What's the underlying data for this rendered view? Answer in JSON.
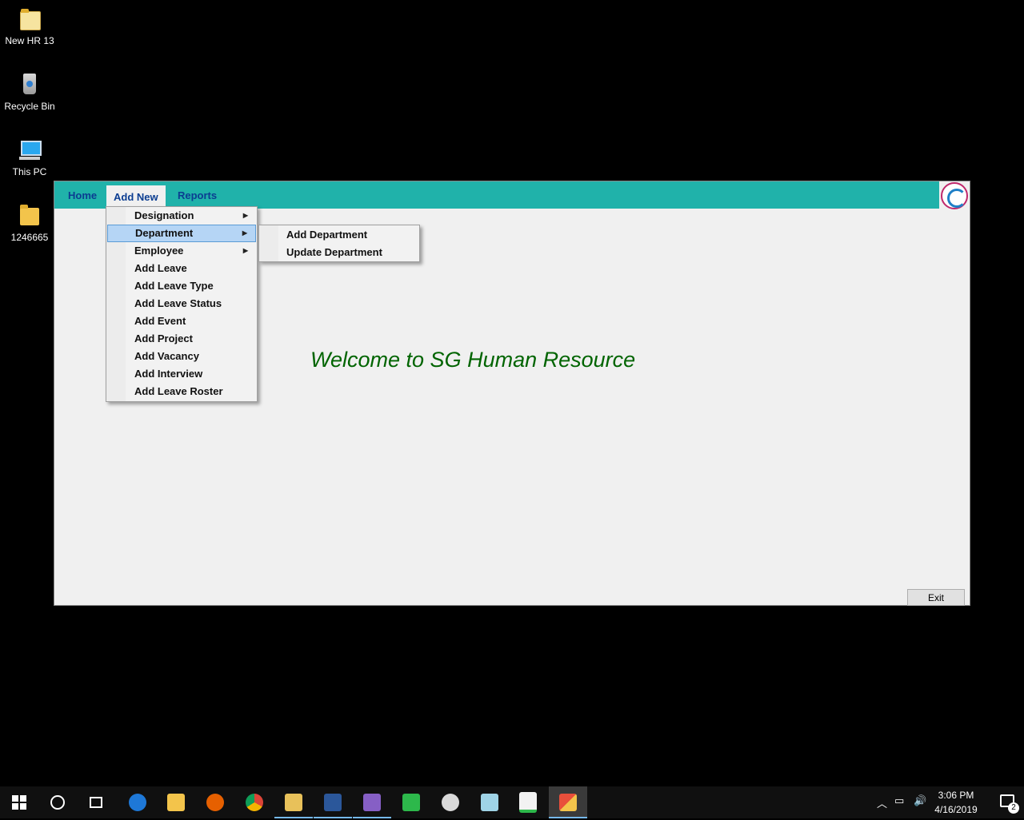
{
  "desktop": {
    "icons": [
      {
        "label": "New HR 13"
      },
      {
        "label": "Recycle Bin"
      },
      {
        "label": "This PC"
      },
      {
        "label": "1246665"
      }
    ]
  },
  "app": {
    "menubar": {
      "home": "Home",
      "add_new": "Add New",
      "reports": "Reports"
    },
    "welcome": "Welcome to SG Human Resource",
    "exit_label": "Exit",
    "colors": {
      "menubar": "#20b2aa",
      "welcome": "#006400",
      "menu_text": "#0b3d91"
    }
  },
  "dropdown": {
    "items": [
      {
        "label": "Designation",
        "submenu": true
      },
      {
        "label": "Department",
        "submenu": true,
        "highlighted": true
      },
      {
        "label": "Employee",
        "submenu": true
      },
      {
        "label": "Add Leave"
      },
      {
        "label": "Add Leave Type"
      },
      {
        "label": "Add Leave Status"
      },
      {
        "label": "Add Event"
      },
      {
        "label": "Add Project"
      },
      {
        "label": "Add Vacancy"
      },
      {
        "label": "Add Interview"
      },
      {
        "label": "Add Leave Roster"
      }
    ]
  },
  "submenu": {
    "items": [
      {
        "label": "Add Department"
      },
      {
        "label": "Update Department"
      }
    ]
  },
  "taskbar": {
    "apps": [
      "start-icon",
      "cortana-icon",
      "task-view-icon",
      "edge-icon",
      "file-explorer-icon",
      "firefox-icon",
      "chrome-icon",
      "sql-tool-icon",
      "word-icon",
      "visual-studio-icon",
      "viewer-icon",
      "paint-icon",
      "notes-icon",
      "project-icon",
      "hr-app-icon"
    ],
    "time": "3:06 PM",
    "date": "4/16/2019",
    "notifications": "2"
  }
}
